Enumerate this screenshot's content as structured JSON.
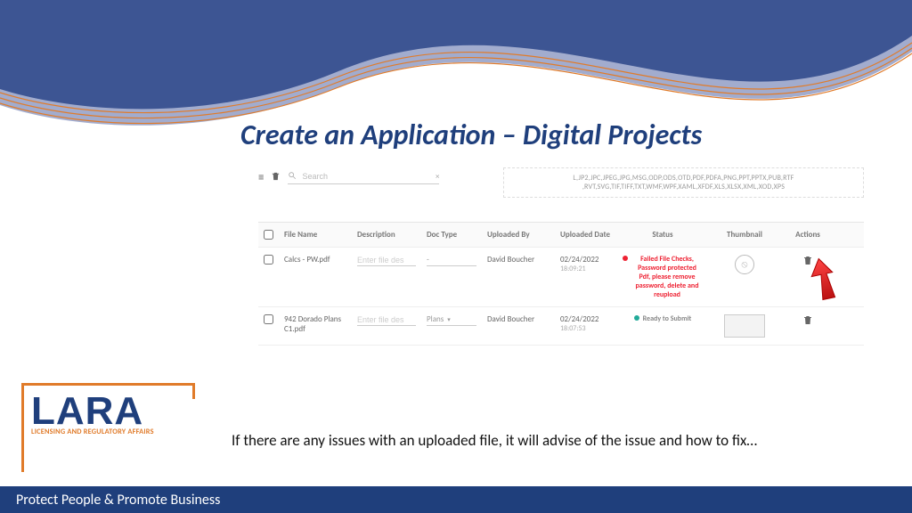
{
  "title": "Create an Application – Digital Projects",
  "toolbar": {
    "search_placeholder": "Search"
  },
  "filetypes_line1": "L,JP2,JPC,JPEG,JPG,MSG,ODP,ODS,OTD,PDF,PDFA,PNG,PPT,PPTX,PUB,RTF",
  "filetypes_line2": ",RVT,SVG,TIF,TIFF,TXT,WMF,WPF,XAML,XFDF,XLS,XLSX,XML,XOD,XPS",
  "columns": {
    "file_name": "File Name",
    "description": "Description",
    "doc_type": "Doc Type",
    "uploaded_by": "Uploaded By",
    "uploaded_date": "Uploaded Date",
    "status": "Status",
    "thumbnail": "Thumbnail",
    "actions": "Actions"
  },
  "rows": [
    {
      "name": "Calcs - PW.pdf",
      "desc_placeholder": "Enter file des",
      "doc_type": "-",
      "uploader": "David Boucher",
      "date": "02/24/2022",
      "time": "18:09:21",
      "status": "Failed File Checks, Password protected Pdf, please remove password, delete and reupload",
      "status_ok": false
    },
    {
      "name": "942 Dorado Plans C1.pdf",
      "desc_placeholder": "Enter file des",
      "doc_type": "Plans",
      "uploader": "David Boucher",
      "date": "02/24/2022",
      "time": "18:07:53",
      "status": "Ready to Submit",
      "status_ok": true
    }
  ],
  "body_text": "If there are any issues with an uploaded file, it will advise of the issue and how to fix…",
  "logo": {
    "main": "LARA",
    "sub": "LICENSING AND REGULATORY AFFAIRS"
  },
  "footer": "Protect People & Promote Business"
}
